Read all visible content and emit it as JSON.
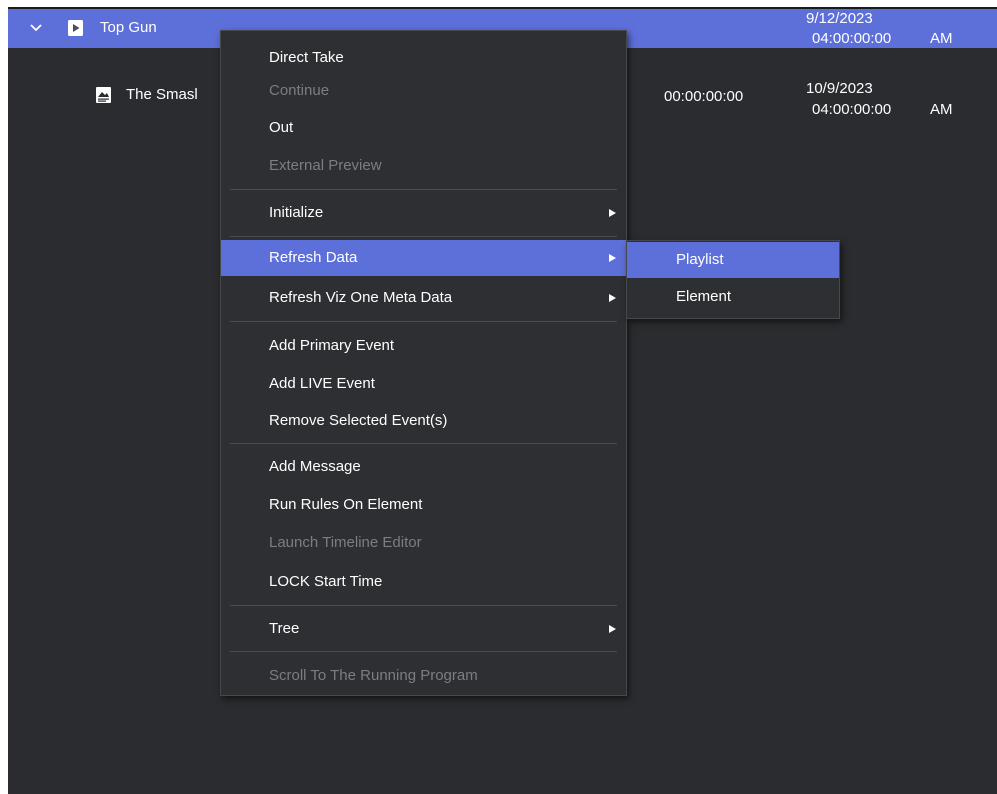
{
  "rows": [
    {
      "title": "Top Gun",
      "date": "9/12/2023",
      "time": "04:00:00:00",
      "ampm": "AM",
      "duration": ""
    },
    {
      "title": "The Smasl",
      "date": "10/9/2023",
      "time": "04:00:00:00",
      "ampm": "AM",
      "duration": "00:00:00:00"
    }
  ],
  "context_menu": {
    "items": [
      {
        "label": "Direct Take"
      },
      {
        "label": "Continue",
        "disabled": true
      },
      {
        "label": "Out"
      },
      {
        "label": "External Preview",
        "disabled": true
      },
      {
        "label": "Initialize",
        "submenu": true
      },
      {
        "label": "Refresh Data",
        "submenu": true,
        "highlighted": true
      },
      {
        "label": "Refresh Viz One Meta Data",
        "submenu": true
      },
      {
        "label": "Add Primary Event"
      },
      {
        "label": "Add LIVE Event"
      },
      {
        "label": "Remove Selected Event(s)"
      },
      {
        "label": "Add Message"
      },
      {
        "label": "Run Rules On Element"
      },
      {
        "label": "Launch Timeline Editor",
        "disabled": true
      },
      {
        "label": "LOCK Start Time"
      },
      {
        "label": "Tree",
        "submenu": true
      },
      {
        "label": "Scroll To The Running Program",
        "disabled": true
      }
    ]
  },
  "submenu": {
    "items": [
      {
        "label": "Playlist",
        "highlighted": true
      },
      {
        "label": "Element"
      }
    ]
  },
  "colors": {
    "panel_bg": "#2b2c2f",
    "selection": "#5d6fd9",
    "menu_bg": "#2e2f33",
    "disabled_text": "#7b7d84"
  },
  "icons": {
    "expand": "chevron-down-icon",
    "playlist_item": "play-document-icon",
    "element": "image-document-icon",
    "submenu_arrow": "triangle-right-icon"
  }
}
